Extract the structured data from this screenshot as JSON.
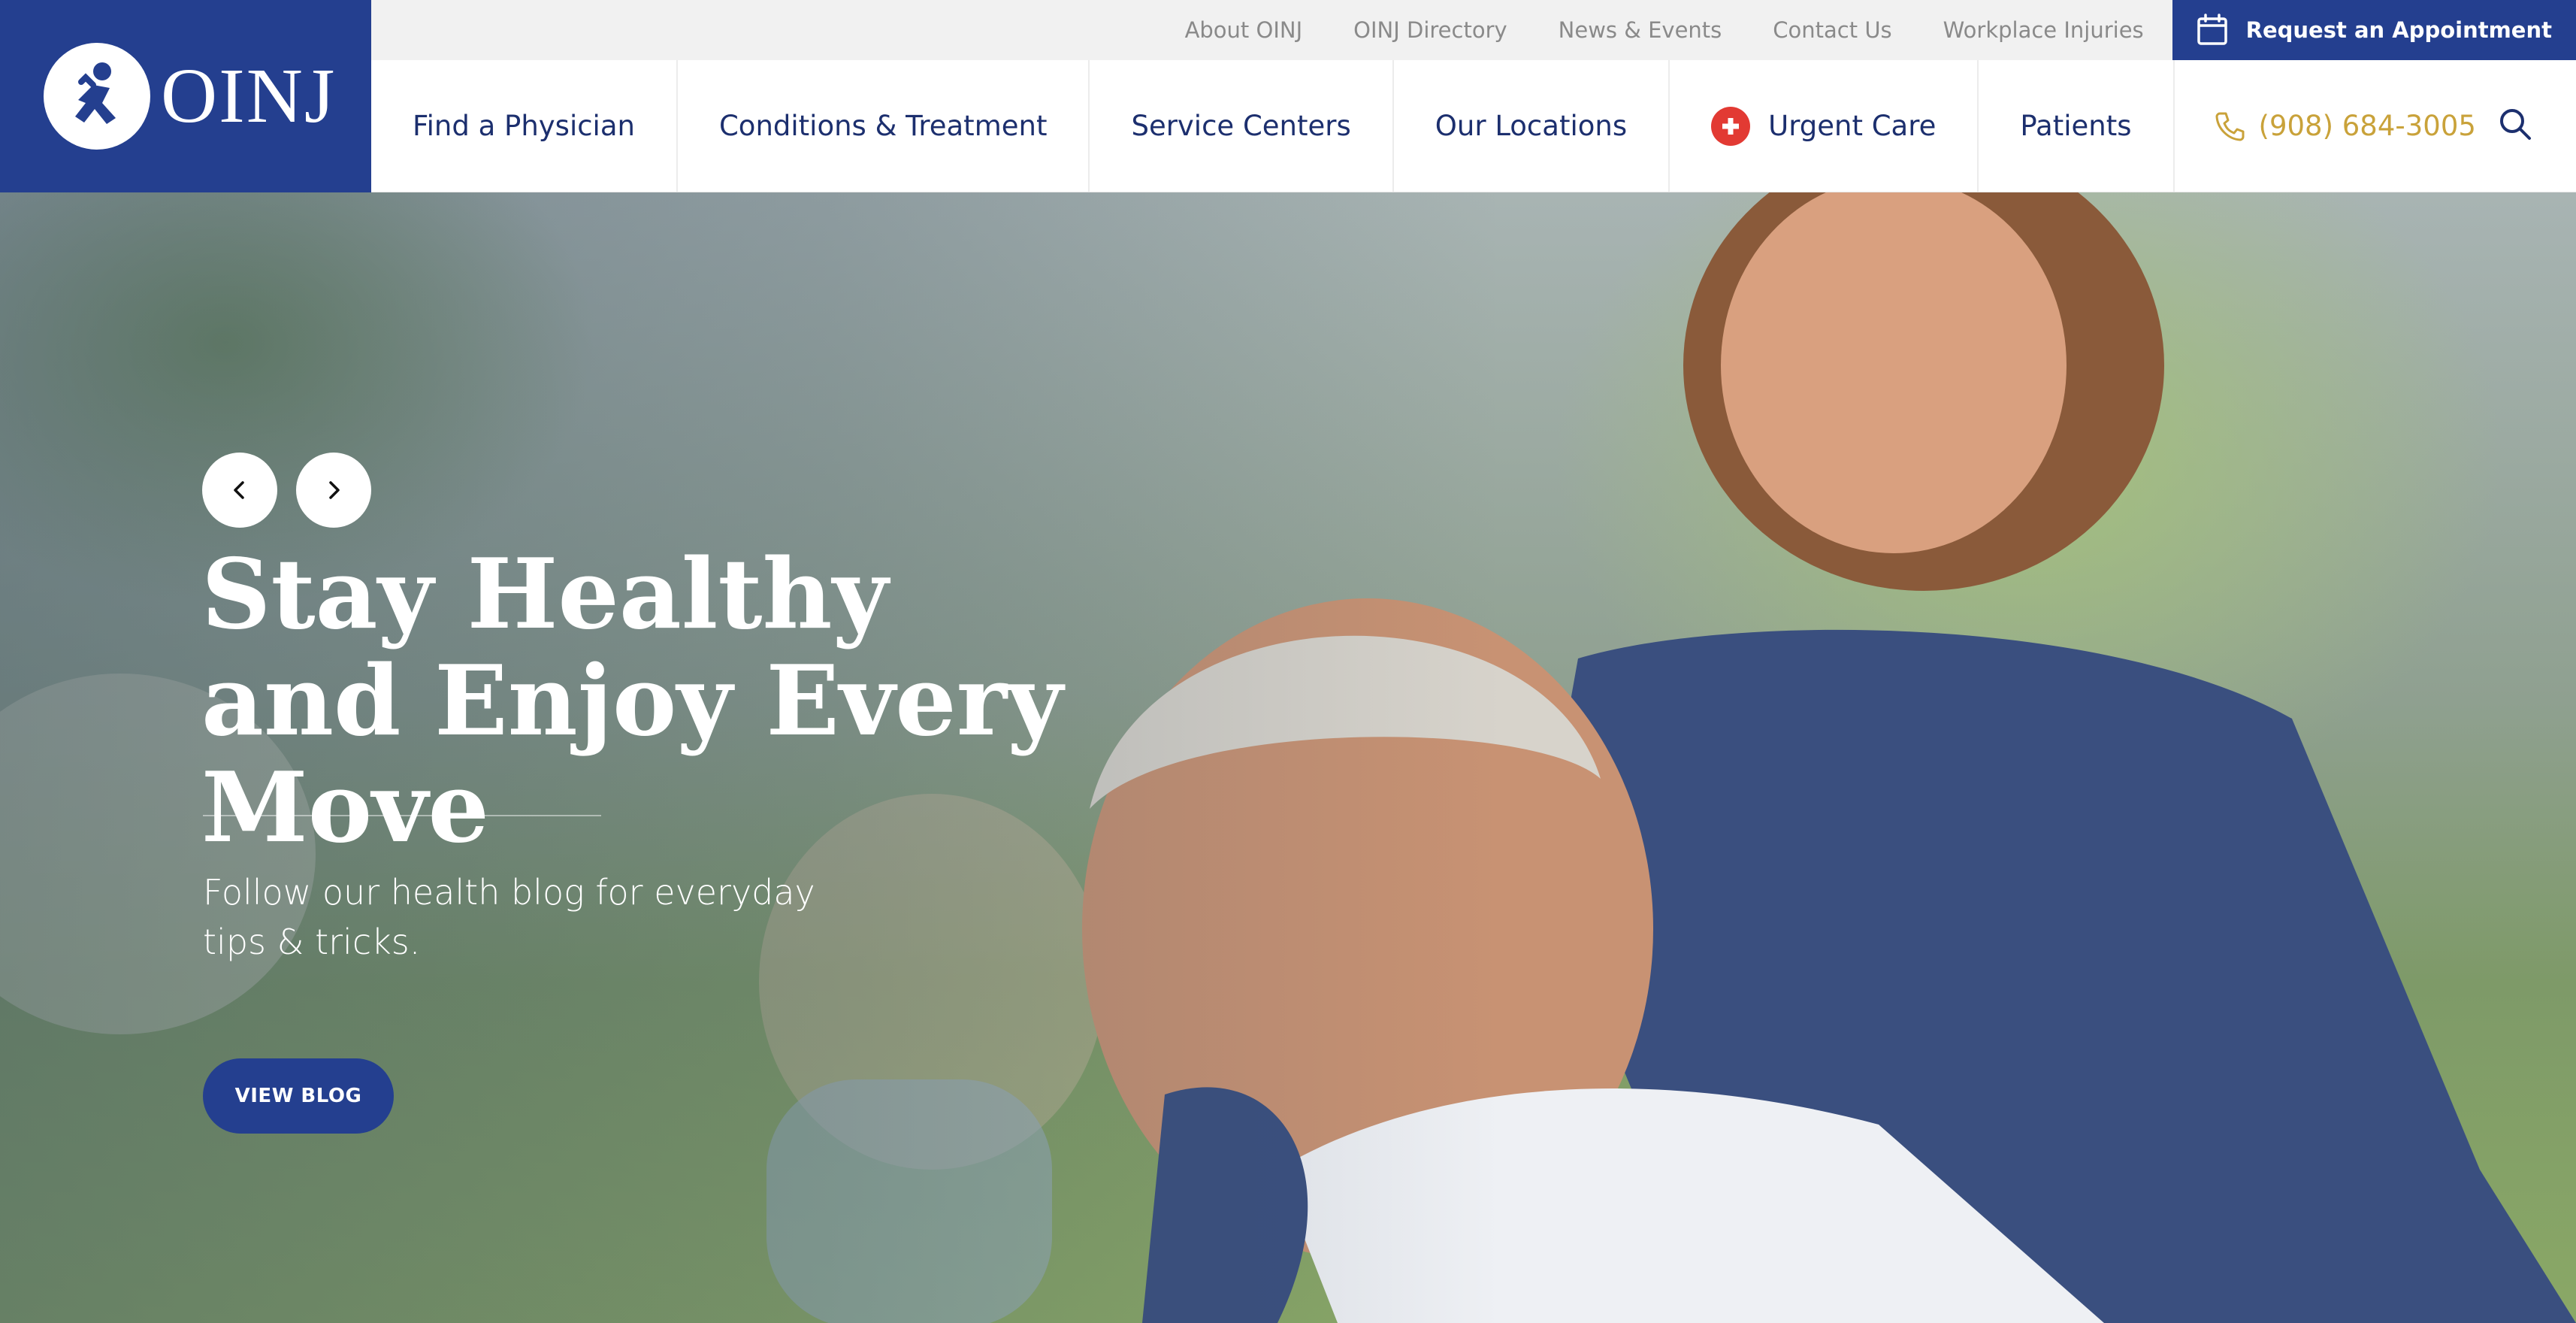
{
  "brand": {
    "name": "OINJ"
  },
  "utility_nav": {
    "links": [
      "About OINJ",
      "OINJ Directory",
      "News & Events",
      "Contact Us",
      "Workplace Injuries"
    ],
    "appointment_label": "Request an Appointment"
  },
  "main_nav": {
    "items": [
      "Find a Physician",
      "Conditions & Treatment",
      "Service Centers",
      "Our Locations",
      "Urgent Care",
      "Patients"
    ],
    "phone": "(908) 684-3005"
  },
  "hero": {
    "title_line1": "Stay Healthy",
    "title_line2": "and Enjoy Every Move",
    "subtitle_line1": "Follow our health blog for everyday",
    "subtitle_line2": "tips & tricks.",
    "cta_label": "VIEW BLOG"
  },
  "icons": {
    "calendar": "calendar-icon",
    "urgent_care": "plus-cross-icon",
    "phone": "phone-icon",
    "search": "search-icon",
    "prev": "chevron-left-icon",
    "next": "chevron-right-icon"
  },
  "colors": {
    "brand_navy": "#243f8f",
    "nav_text": "#1c2f6e",
    "phone_gold": "#c9a23a",
    "urgent_red": "#e23a33",
    "utility_bg": "#f1f1f1"
  }
}
